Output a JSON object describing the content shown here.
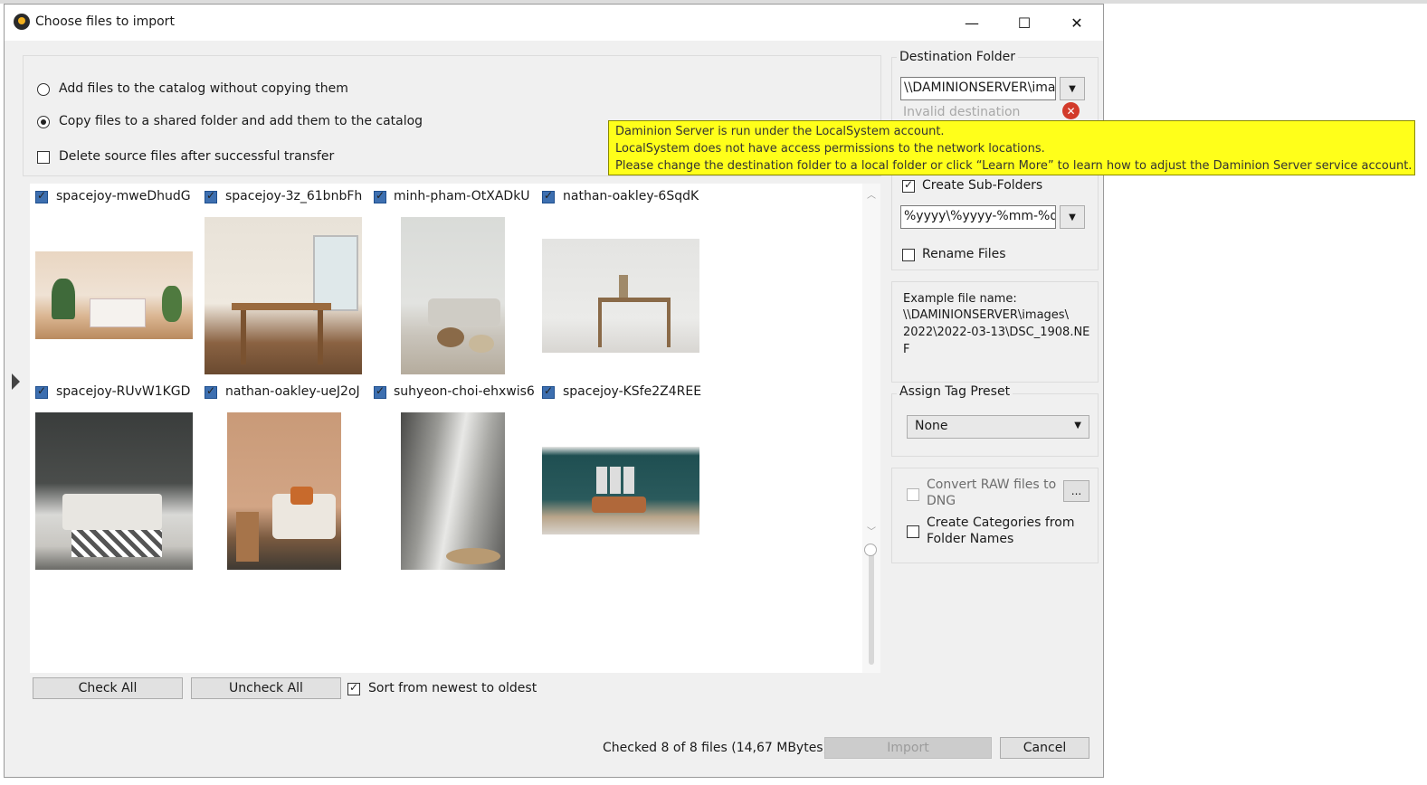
{
  "window": {
    "title": "Choose files to import",
    "minimize": "—",
    "maximize": "☐",
    "close": "✕"
  },
  "options": {
    "add_without_copy": "Add files to the catalog without copying them",
    "copy_to_shared": "Copy files to a shared folder and add them to the catalog",
    "delete_source": "Delete source files after successful transfer",
    "selected": "copy_to_shared"
  },
  "files": [
    {
      "name": "spacejoy-mweDhudG",
      "checked": true
    },
    {
      "name": "spacejoy-3z_61bnbFh",
      "checked": true
    },
    {
      "name": "minh-pham-OtXADkU",
      "checked": true
    },
    {
      "name": "nathan-oakley-6SqdK",
      "checked": true
    },
    {
      "name": "spacejoy-RUvW1KGD",
      "checked": true
    },
    {
      "name": "nathan-oakley-uеJ2oJ",
      "checked": true
    },
    {
      "name": "suhyeon-choi-ehxwis6",
      "checked": true
    },
    {
      "name": "spacejoy-KSfe2Z4REE",
      "checked": true
    }
  ],
  "bottom": {
    "check_all": "Check All",
    "uncheck_all": "Uncheck All",
    "sort_label": "Sort from newest to oldest",
    "status": "Checked 8 of 8 files (14,67 MBytes)",
    "import": "Import",
    "cancel": "Cancel"
  },
  "destination": {
    "title": "Destination Folder",
    "path": "\\\\DAMINIONSERVER\\images",
    "invalid": "Invalid destination",
    "create_subfolders": "Create Sub-Folders",
    "subfolder_pattern": "%yyyy\\%yyyy-%mm-%dd",
    "rename_files": "Rename Files",
    "example_label": "Example file name:",
    "example_line1": "\\\\DAMINIONSERVER\\images\\",
    "example_line2": "2022\\2022-03-13\\DSC_1908.NE",
    "example_line3": "F"
  },
  "tag_preset": {
    "title": "Assign Tag Preset",
    "value": "None"
  },
  "extra": {
    "convert_raw_1": "Convert RAW files to",
    "convert_raw_2": "DNG",
    "ellipsis": "...",
    "create_categories_1": "Create Categories from",
    "create_categories_2": "Folder Names"
  },
  "tooltip": {
    "line1": "Daminion Server is run under the LocalSystem account.",
    "line2": "LocalSystem does not have access permissions to the network locations.",
    "line3": "Please change the destination folder to a local folder or click “Learn More” to learn how to adjust the Daminion Server service account."
  },
  "colors": {
    "tooltip_bg": "#ffff1a",
    "window_bg": "#f0f0f0",
    "check_blue": "#3d6fb0",
    "error_red": "#d23a2a"
  }
}
